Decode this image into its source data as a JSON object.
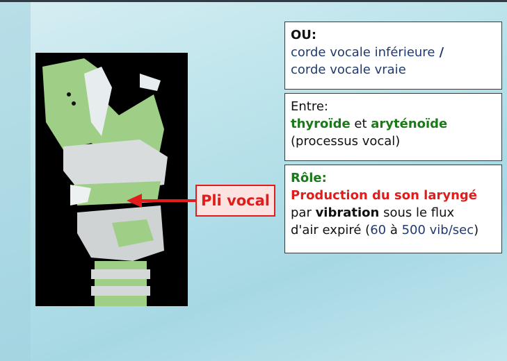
{
  "box1": {
    "title": "OU:",
    "line1": "corde vocale inférieure",
    "slash": " /",
    "line2": "corde vocale vraie"
  },
  "box2": {
    "line1": "Entre:",
    "term1": "thyroïde",
    "conj": " et ",
    "term2": "aryténoïde",
    "line3": "(processus vocal)"
  },
  "box3": {
    "title": "Rôle:",
    "line1": "Production du son laryngé",
    "line2_pre": "par ",
    "line2_bold": "vibration",
    "line2_post": " sous le flux",
    "line3_pre": "d'air expiré (",
    "n1": "60",
    "mid": " à ",
    "n2": "500 vib/sec",
    "close": ")"
  },
  "label": "Pli vocal",
  "colors": {
    "red": "#e21b1b",
    "green": "#1a7a1a",
    "navy": "#1f3a6e"
  },
  "icons": {
    "arrow": "arrow-left-icon",
    "image": "larynx-section-image"
  }
}
